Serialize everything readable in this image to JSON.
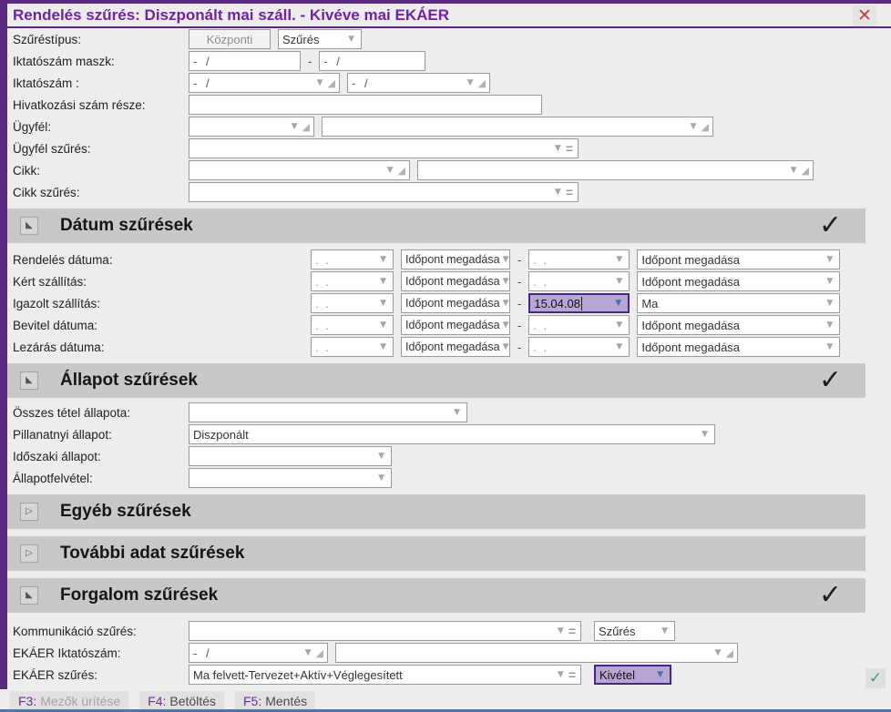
{
  "window": {
    "title": "Rendelés szűrés: Diszponált mai száll. - Kivéve mai EKÁER"
  },
  "icons": {
    "close": "✕",
    "check": "✓",
    "green_check": "✓",
    "dropdown": "▼",
    "corner": "◢",
    "expanded": "◣",
    "collapsed": "▷",
    "equals": "="
  },
  "form": {
    "szurestipus": {
      "label": "Szűréstípus:",
      "readonly_value": "Központi",
      "mode": "Szűrés"
    },
    "iktatoszam_maszk": {
      "label": "Iktatószám maszk:",
      "from": "- /",
      "dash": "-",
      "to": "- /"
    },
    "iktatoszam": {
      "label": "Iktatószám :",
      "from": "- /",
      "to": "- /"
    },
    "hivatkozasi": {
      "label": "Hivatkozási szám része:",
      "value": ""
    },
    "ugyfel": {
      "label": "Ügyfél:",
      "code": "",
      "name": ""
    },
    "ugyfel_szures": {
      "label": "Ügyfél szűrés:",
      "value": ""
    },
    "cikk": {
      "label": "Cikk:",
      "code": "",
      "name": ""
    },
    "cikk_szures": {
      "label": "Cikk szűrés:",
      "value": ""
    }
  },
  "sections": {
    "datum": {
      "title": "Dátum szűrések",
      "state": "expanded"
    },
    "allapot": {
      "title": "Állapot szűrések",
      "state": "expanded"
    },
    "egyeb": {
      "title": "Egyéb szűrések",
      "state": "collapsed"
    },
    "tovabbi": {
      "title": "További adat szűrések",
      "state": "collapsed"
    },
    "forgalom": {
      "title": "Forgalom szűrések",
      "state": "expanded"
    }
  },
  "date_rows": [
    {
      "label": "Rendelés dátuma:",
      "from_date": ". .",
      "from_mode": "Időpont megadása",
      "dash": "-",
      "to_date": ". .",
      "to_mode": "Időpont megadása"
    },
    {
      "label": "Kért szállítás:",
      "from_date": ". .",
      "from_mode": "Időpont megadása",
      "dash": "-",
      "to_date": ". .",
      "to_mode": "Időpont megadása"
    },
    {
      "label": "Igazolt szállítás:",
      "from_date": ". .",
      "from_mode": "Időpont megadása",
      "dash": "-",
      "to_date": "15.04.08",
      "to_mode": "Ma"
    },
    {
      "label": "Bevitel dátuma:",
      "from_date": ". .",
      "from_mode": "Időpont megadása",
      "dash": "-",
      "to_date": ". .",
      "to_mode": "Időpont megadása"
    },
    {
      "label": "Lezárás dátuma:",
      "from_date": ". .",
      "from_mode": "Időpont megadása",
      "dash": "-",
      "to_date": ". .",
      "to_mode": "Időpont megadása"
    }
  ],
  "allapot_rows": [
    {
      "label": "Összes tétel állapota:",
      "value": ""
    },
    {
      "label": "Pillanatnyi állapot:",
      "value": "Diszponált"
    },
    {
      "label": "Időszaki állapot:",
      "value": ""
    },
    {
      "label": "Állapotfelvétel:",
      "value": ""
    }
  ],
  "forgalom_rows": {
    "kommunikacio": {
      "label": "Kommunikáció szűrés:",
      "value": "",
      "mode": "Szűrés"
    },
    "ekaer_iktatoszam": {
      "label": "EKÁER Iktatószám:",
      "from": "- /",
      "to": ""
    },
    "ekaer_szures": {
      "label": "EKÁER szűrés:",
      "value": "Ma felvett-Tervezet+Aktív+Véglegesített",
      "mode": "Kivétel"
    }
  },
  "footer": {
    "buttons": [
      {
        "key": "F3:",
        "label": "Mezők ürítése"
      },
      {
        "key": "F4:",
        "label": "Betöltés"
      },
      {
        "key": "F5:",
        "label": "Mentés"
      }
    ]
  }
}
